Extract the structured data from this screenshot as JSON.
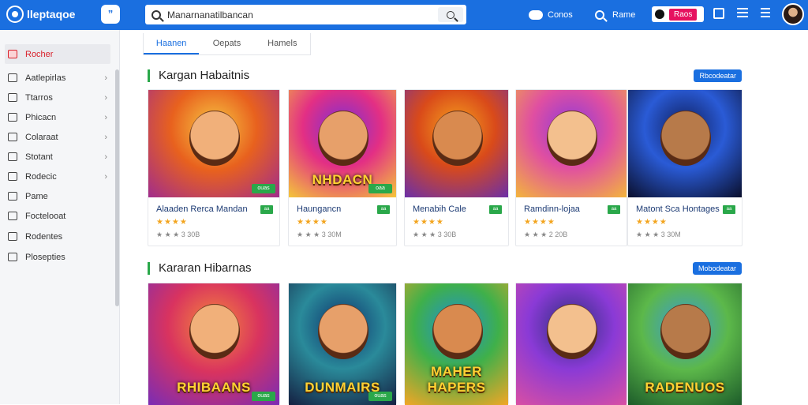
{
  "colors": {
    "brand": "#1a6fe0",
    "accent_green": "#2aa84a",
    "active_red": "#d9232d",
    "pill_pink": "#e6125f"
  },
  "header": {
    "logo_text": "lleptaqoe",
    "chat_label": "”",
    "search": {
      "value": "Manarnanatilbancan",
      "placeholder": ""
    },
    "games_label": "Conos",
    "search_nav_label": "Rame",
    "pill_label": "Raos"
  },
  "sidebar": {
    "items": [
      {
        "label": "Rocher",
        "icon": "home-icon",
        "chevron": ""
      },
      {
        "label": "Aatlepirlas",
        "icon": "card-icon",
        "chevron": "›"
      },
      {
        "label": "Ttarros",
        "icon": "house-icon",
        "chevron": "›"
      },
      {
        "label": "Phicacn",
        "icon": "doc-icon",
        "chevron": "›"
      },
      {
        "label": "Colaraat",
        "icon": "tag-icon",
        "chevron": "›"
      },
      {
        "label": "Stotant",
        "icon": "pencil-icon",
        "chevron": "›"
      },
      {
        "label": "Rodecic",
        "icon": "list-icon",
        "chevron": "›"
      },
      {
        "label": "Pame",
        "icon": "grid-icon",
        "chevron": ""
      },
      {
        "label": "Foctelooat",
        "icon": "circle-icon",
        "chevron": ""
      },
      {
        "label": "Rodentes",
        "icon": "image-icon",
        "chevron": ""
      },
      {
        "label": "Plosepties",
        "icon": "frame-icon",
        "chevron": ""
      }
    ]
  },
  "tabs": [
    "Haanen",
    "Oepats",
    "Hamels"
  ],
  "sections": [
    {
      "title": "Kargan Habaitnis",
      "view_all": "Rbcodeatar",
      "cards": [
        {
          "title": "Alaaden Rerca Mandan",
          "tag": "aa",
          "badge": "ouas",
          "stars": "★★★★",
          "meta": "★ ★ ★ 3 30B",
          "word": ""
        },
        {
          "title": "Haungancn",
          "tag": "aa",
          "badge": "oaa",
          "stars": "★★★★",
          "meta": "★ ★ ★ 3 30M",
          "word": "NHDACN"
        },
        {
          "title": "Menabih Cale",
          "tag": "aa",
          "badge": "",
          "stars": "★★★★",
          "meta": "★ ★ ★ 3 30B",
          "word": ""
        },
        {
          "title": "Ramdinn-lojaa",
          "tag": "aa",
          "badge": "",
          "stars": "★★★★",
          "meta": "★ ★ ★ 2 20B",
          "word": ""
        },
        {
          "title": "Matont Sca Hontages",
          "tag": "aa",
          "badge": "",
          "stars": "★★★★",
          "meta": "★ ★ ★ 3 30M",
          "word": ""
        }
      ]
    },
    {
      "title": "Kararan Hibarnas",
      "view_all": "Mobodeatar",
      "cards": [
        {
          "title": "",
          "tag": "",
          "badge": "ouas",
          "stars": "",
          "meta": "",
          "word": "RHIBAANS"
        },
        {
          "title": "",
          "tag": "",
          "badge": "ouas",
          "stars": "",
          "meta": "",
          "word": "DUNMAIRS"
        },
        {
          "title": "",
          "tag": "",
          "badge": "",
          "stars": "",
          "meta": "",
          "word": "MAHER HAPERS"
        },
        {
          "title": "",
          "tag": "",
          "badge": "",
          "stars": "",
          "meta": "",
          "word": ""
        },
        {
          "title": "",
          "tag": "",
          "badge": "",
          "stars": "",
          "meta": "",
          "word": "RADENUOS"
        }
      ]
    }
  ]
}
